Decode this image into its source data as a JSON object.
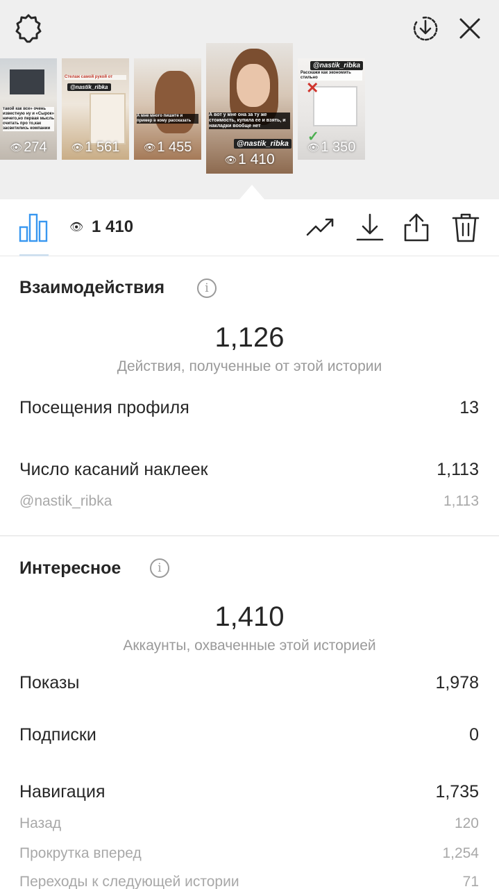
{
  "colors": {
    "accent": "#3897f0",
    "text": "#262626",
    "muted": "#9a9a9a",
    "strip_bg": "#efefef"
  },
  "stories": [
    {
      "views": "274",
      "caption": "такой как все» очень известную ну и «Сырок» ничего,но первая мысль считать про то,как засветились компании"
    },
    {
      "views": "1 561",
      "caption": "Стелаж самой рукой от",
      "tag": "@nastik_ribka"
    },
    {
      "views": "1 455",
      "caption": "А мне много пишите и пример в кому рассказать"
    },
    {
      "views": "1 410",
      "caption": "А вот у мне она за ту же стоимость, купила ее и взять, и накладки вообще нет",
      "tag": "@nastik_ribka"
    },
    {
      "views": "1 350",
      "caption": "Расскажи как экономить стильно",
      "tag": "@nastik_ribka"
    }
  ],
  "toolbar": {
    "views": "1 410"
  },
  "interactions": {
    "title": "Взаимодействия",
    "total": "1,126",
    "total_label": "Действия, полученные от этой истории",
    "profile_visits_label": "Посещения профиля",
    "profile_visits": "13",
    "sticker_taps_label": "Число касаний наклеек",
    "sticker_taps": "1,113",
    "sticker_handle": "@nastik_ribka",
    "sticker_handle_taps": "1,113"
  },
  "discovery": {
    "title": "Интересное",
    "reach": "1,410",
    "reach_label": "Аккаунты, охваченные этой историей",
    "impressions_label": "Показы",
    "impressions": "1,978",
    "follows_label": "Подписки",
    "follows": "0",
    "navigation_label": "Навигация",
    "navigation": "1,735",
    "back_label": "Назад",
    "back": "120",
    "forward_label": "Прокрутка вперед",
    "forward": "1,254",
    "next_story_label": "Переходы к следующей истории",
    "next_story": "71"
  }
}
